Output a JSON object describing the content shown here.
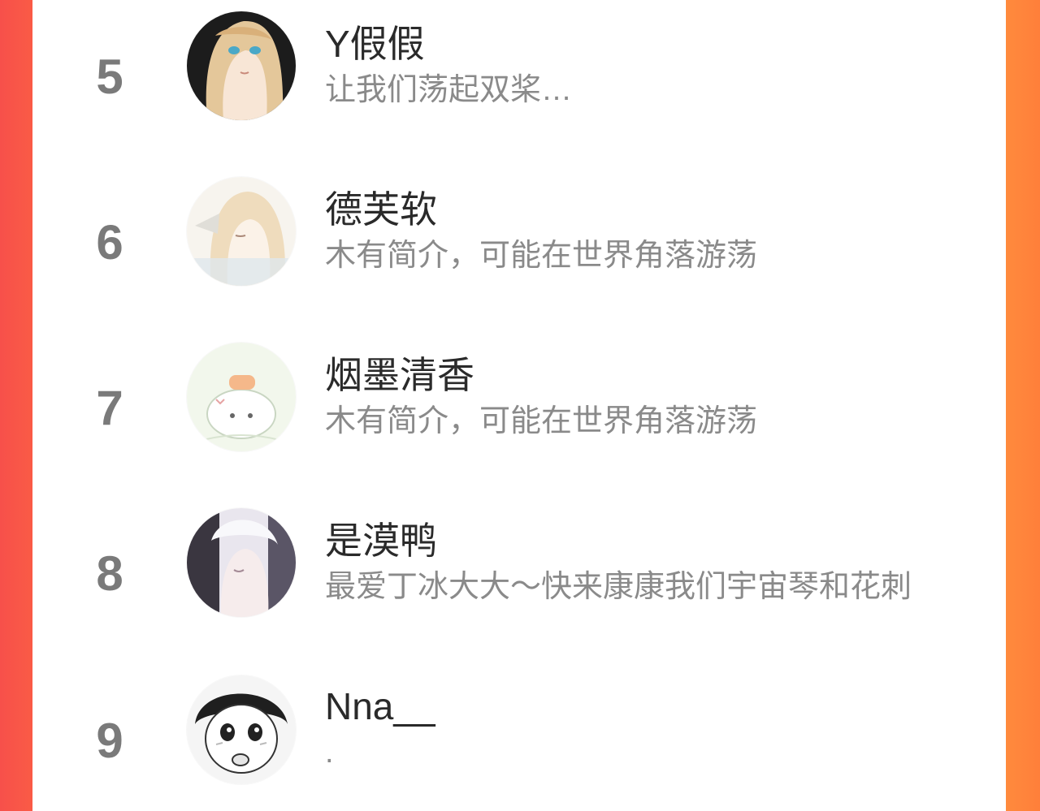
{
  "ranking": {
    "items": [
      {
        "rank": "5",
        "name": "Y假假",
        "bio": "让我们荡起双桨…",
        "avatar_icon": "anime-girl-blonde-icon"
      },
      {
        "rank": "6",
        "name": "德芙软",
        "bio": "木有简介，可能在世界角落游荡",
        "avatar_icon": "anime-girl-sketch-icon"
      },
      {
        "rank": "7",
        "name": "烟墨清香",
        "bio": "木有简介，可能在世界角落游荡",
        "avatar_icon": "cute-bun-character-icon"
      },
      {
        "rank": "8",
        "name": "是漠鸭",
        "bio": "最爱丁冰大大～快来康康我们宇宙琴和花刺",
        "avatar_icon": "anime-boy-white-hair-icon"
      },
      {
        "rank": "9",
        "name": "Nna__",
        "bio": ".",
        "avatar_icon": "manga-girl-blushing-icon"
      }
    ]
  },
  "colors": {
    "left_edge": "#f7504a",
    "right_edge": "#ff8a3d",
    "rank_text": "#7a7a7a",
    "name_text": "#2a2a2a",
    "bio_text": "#8a8a8a"
  }
}
